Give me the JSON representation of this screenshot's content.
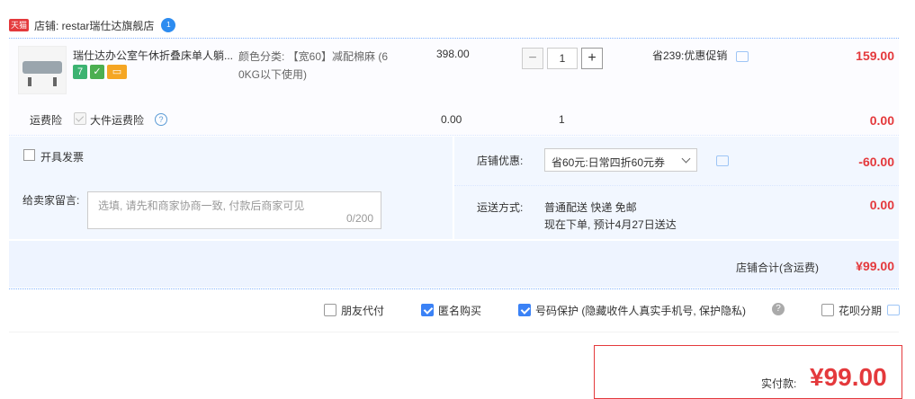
{
  "shop": {
    "badge": "天猫",
    "label": "店铺: restar瑞仕达旗舰店",
    "chat_badge": "1"
  },
  "item": {
    "title": "瑞仕达办公室午休折叠床单人躺...",
    "sku_label": "颜色分类: 【宽60】减配棉麻 (60KG以下使用)",
    "sku_line1": "颜色分类: 【宽60】减配棉麻 (6",
    "sku_line2": "0KG以下使用)",
    "price": "398.00",
    "quantity": "1",
    "promo": "省239:优惠促销",
    "total": "159.00",
    "badges": [
      "7",
      "✓",
      "▭"
    ]
  },
  "insurance": {
    "label": "运费险",
    "name": "大件运费险",
    "price": "0.00",
    "quantity": "1",
    "total": "0.00"
  },
  "invoice": {
    "label": "开具发票"
  },
  "memo": {
    "label": "给卖家留言:",
    "placeholder": "选填, 请先和商家协商一致, 付款后商家可见",
    "count": "0/200"
  },
  "discount": {
    "label": "店铺优惠:",
    "selected": "省60元:日常四折60元券",
    "total": "-60.00"
  },
  "shipping": {
    "label": "运送方式:",
    "method": "普通配送 快递 免邮",
    "eta": "现在下单, 预计4月27日送达",
    "total": "0.00"
  },
  "summary": {
    "label": "店铺合计(含运费)",
    "total": "¥99.00"
  },
  "options": {
    "friend_pay": "朋友代付",
    "anonymous": "匿名购买",
    "number_protect": "号码保护 (隐藏收件人真实手机号, 保护隐私)",
    "huabei": "花呗分期"
  },
  "payment": {
    "label": "实付款:",
    "total": "¥99.00"
  },
  "colors": {
    "accent_red": "#e4393c",
    "check_blue": "#3b82f6",
    "panel_blue": "#f2f7ff"
  }
}
